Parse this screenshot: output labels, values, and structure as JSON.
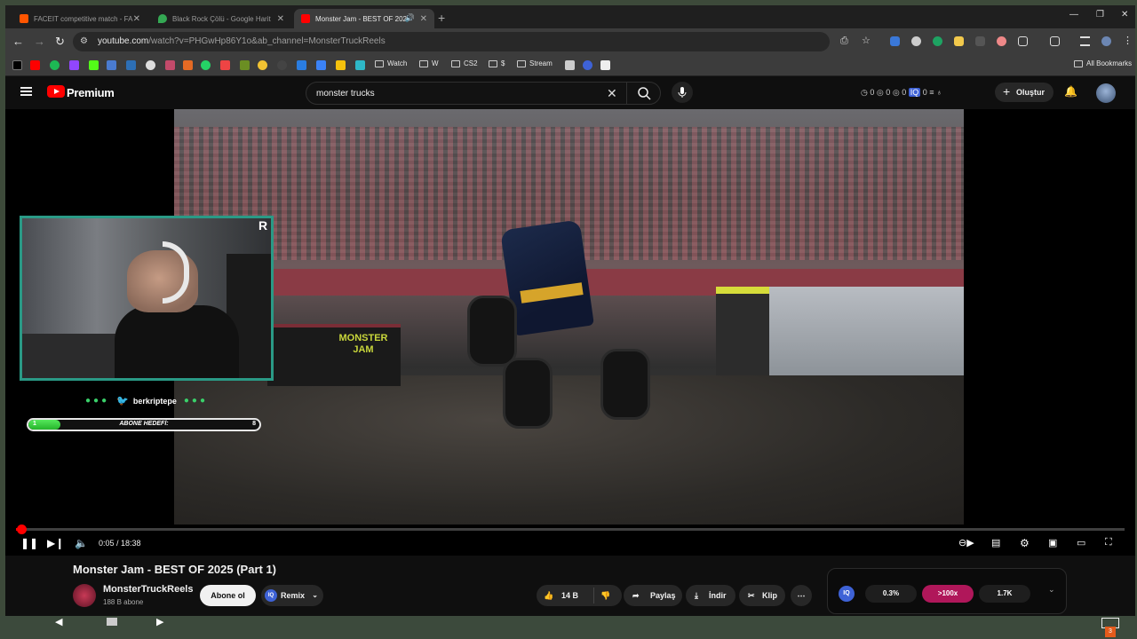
{
  "browser": {
    "tabs": [
      {
        "title": "FACEIT competitive match - FA",
        "color": "#ff5500"
      },
      {
        "title": "Black Rock Çölü - Google Harit",
        "color": "#34a853"
      },
      {
        "title": "Monster Jam - BEST OF 202",
        "color": "#ff0000"
      }
    ],
    "url_host": "youtube.com",
    "url_path": "/watch?v=PHGwHp86Y1o&ab_channel=MonsterTruckReels",
    "bookmarks": [
      "Watch",
      "W",
      "CS2",
      "$",
      "Stream"
    ],
    "all_bookmarks": "All Bookmarks"
  },
  "youtube": {
    "logo_text": "Premium",
    "search_query": "monster trucks",
    "counters": [
      "0",
      "0",
      "0",
      "0"
    ],
    "create_label": "Oluştur"
  },
  "overlay": {
    "streamer_name": "berkriptepe",
    "sub_current": "1",
    "sub_label": "ABONE HEDEFİ:",
    "sub_goal": "8",
    "sub_progress": 0.125,
    "stream_badge": "R"
  },
  "player": {
    "time_text": "0:05 / 18:38",
    "progress_fraction": 0.0045,
    "scene_text": "MONSTER JAM"
  },
  "video": {
    "title": "Monster Jam - BEST OF 2025 (Part 1)",
    "channel": "MonsterTruckReels",
    "subscribers": "188 B abone",
    "subscribe_label": "Abone ol",
    "remix_label": "Remix",
    "likes": "14 B",
    "share_label": "Paylaş",
    "download_label": "İndir",
    "clip_label": "Klip"
  },
  "stats_panel": {
    "badge": "IQ",
    "values": [
      "0.3%",
      ">100x",
      "1.7K"
    ],
    "colors": [
      "#1e1e1e",
      "#b0175a",
      "#1e1e1e"
    ]
  },
  "taskbar": {
    "mail_count": "3"
  }
}
